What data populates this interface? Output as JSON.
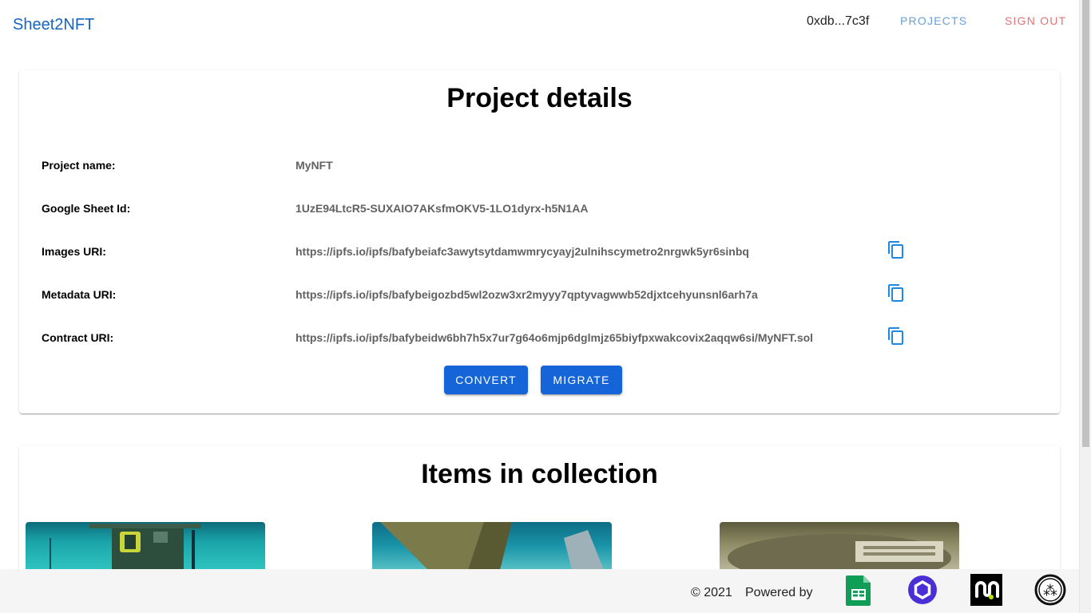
{
  "header": {
    "brand": "Sheet2NFT",
    "address": "0xdb...7c3f",
    "nav": {
      "projects": "PROJECTS",
      "sign_out": "SIGN OUT"
    }
  },
  "details": {
    "title": "Project details",
    "rows": [
      {
        "label": "Project name:",
        "value": "MyNFT"
      },
      {
        "label": "Google Sheet Id:",
        "value": "1UzE94LtcR5-SUXAIO7AKsfmOKV5-1LO1dyrx-h5N1AA"
      },
      {
        "label": "Images URI:",
        "value": "https://ipfs.io/ipfs/bafybeiafc3awytsytdamwmrycyayj2ulnihscymetro2nrgwk5yr6sinbq"
      },
      {
        "label": "Metadata URI:",
        "value": "https://ipfs.io/ipfs/bafybeigozbd5wl2ozw3xr2myyy7qptyvagwwb52djxtcehyunsnl6arh7a"
      },
      {
        "label": "Contract URI:",
        "value": "https://ipfs.io/ipfs/bafybeidw6bh7h5x7ur7g64o6mjp6dglmjz65biyfpxwakcovix2aqqw6si/MyNFT.sol"
      }
    ],
    "buttons": {
      "convert": "CONVERT",
      "migrate": "MIGRATE"
    },
    "copy_icon": "copy-icon"
  },
  "items": {
    "title": "Items in collection"
  },
  "footer": {
    "copyright": "© 2021",
    "powered_by": "Powered by",
    "logos": [
      "google-sheets-icon",
      "chainlink-icon",
      "moralis-icon",
      "ipfs-icon"
    ]
  },
  "colors": {
    "brand": "#1565c0",
    "primary_button": "#1565d8",
    "projects_link": "#6a9fd8",
    "sign_out_link": "#e57373",
    "copy_icon": "#1e88e5"
  }
}
